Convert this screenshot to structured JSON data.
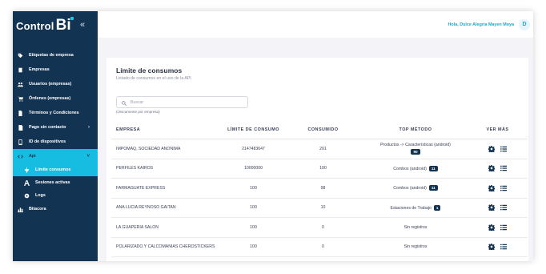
{
  "brand": {
    "name": "Control",
    "suffix": "Bi"
  },
  "sidebar": {
    "items": [
      {
        "label": "Etiquetas de empresa",
        "icon": "tag-icon"
      },
      {
        "label": "Empresas",
        "icon": "building-icon"
      },
      {
        "label": "Usuarios (empresas)",
        "icon": "users-icon"
      },
      {
        "label": "Órdenes (empresas)",
        "icon": "cart-icon"
      },
      {
        "label": "Términos y Condiciones",
        "icon": "document-icon"
      },
      {
        "label": "Pago sin contacto",
        "icon": "payment-icon",
        "chevron": "›"
      },
      {
        "label": "ID de dispositivos",
        "icon": "device-icon"
      },
      {
        "label": "Api",
        "icon": "code-icon",
        "chevron": "˅"
      }
    ],
    "subitems": [
      {
        "label": "Límite consumos",
        "icon": "scale-icon"
      },
      {
        "label": "Sesiones activas",
        "icon": "font-icon"
      },
      {
        "label": "Logs",
        "icon": "settings-icon"
      }
    ],
    "bottom": {
      "label": "Bitacora",
      "icon": "chart-icon"
    }
  },
  "header": {
    "greeting": "Hola, Dulce Alegría Mayen Moya",
    "avatar_initial": "D"
  },
  "main": {
    "title": "Límite de consumos",
    "subtitle": "Listado de consumos en el uso de la API",
    "search": {
      "placeholder": "Buscar",
      "hint": "(Únicamente por empresa)"
    },
    "columns": [
      "EMPRESA",
      "LÍMITE DE CONSUMO",
      "CONSUMIDO",
      "TOP MÉTODO",
      "VER MÁS"
    ],
    "rows": [
      {
        "empresa": "IMPOMAQ, SOCIEDAD ANONIMA",
        "limite": "2147483647",
        "consumido": "201",
        "metodo": "Productos -> Características (android)",
        "count": "90"
      },
      {
        "empresa": "PERFILES KAIROS",
        "limite": "10000000",
        "consumido": "100",
        "metodo": "Combos (android)",
        "count": "11"
      },
      {
        "empresa": "FARMAGUATE EXPRESS",
        "limite": "100",
        "consumido": "98",
        "metodo": "Combos (android)",
        "count": "11"
      },
      {
        "empresa": "ANA LUCIA REYNOSO GAITAN",
        "limite": "100",
        "consumido": "10",
        "metodo": "Estaciones de Trabajo",
        "count": "1"
      },
      {
        "empresa": "LA GUAPERIA SALON",
        "limite": "100",
        "consumido": "0",
        "metodo": "Sin registros",
        "count": ""
      },
      {
        "empresa": "POLARIZADO Y CALCOMANIAS CHEROSTICKERS",
        "limite": "100",
        "consumido": "0",
        "metodo": "Sin registros",
        "count": ""
      }
    ]
  },
  "colors": {
    "sidebar": "#133352",
    "accent": "#16bde0",
    "badge": "#133352"
  }
}
